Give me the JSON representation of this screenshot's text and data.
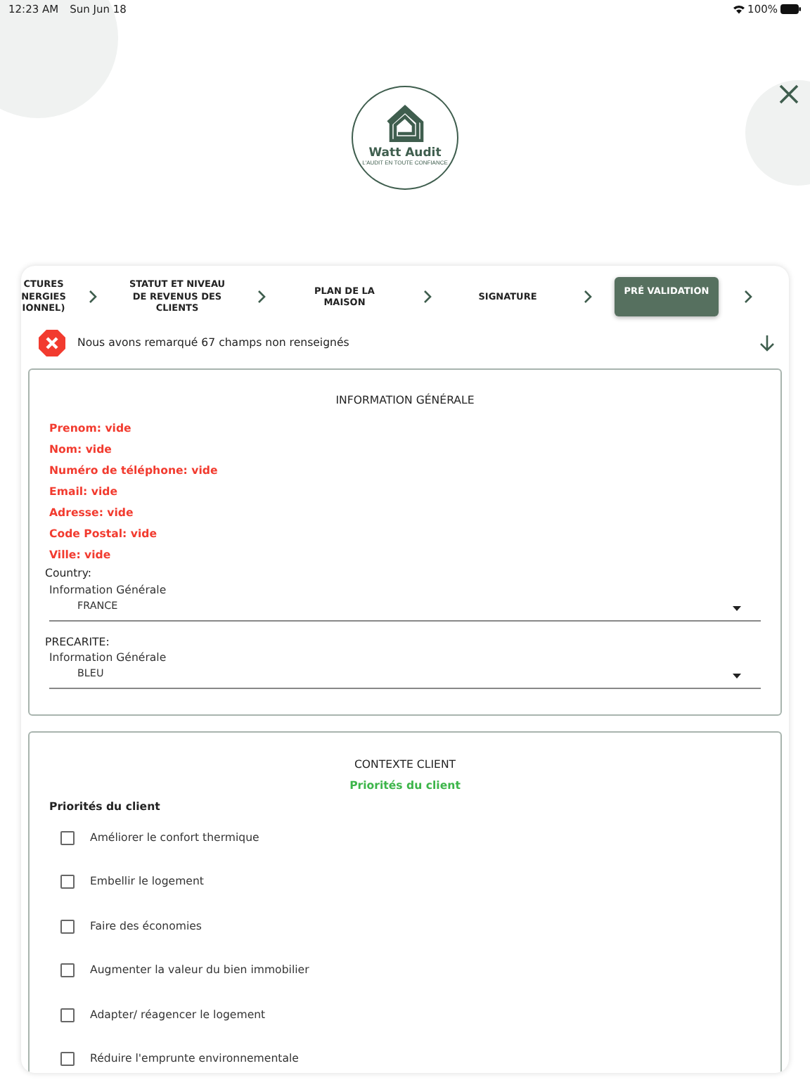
{
  "status_bar": {
    "time": "12:23 AM",
    "date": "Sun Jun 18",
    "battery": "100%"
  },
  "logo": {
    "title": "Watt Audit",
    "tagline": "L'AUDIT EN TOUTE CONFIANCE"
  },
  "steps": [
    {
      "label": "CTURES\nNERGIES\nIONNEL)",
      "selected": false
    },
    {
      "label": "STATUT ET NIVEAU\nDE REVENUS DES\nCLIENTS",
      "selected": false
    },
    {
      "label": "PLAN DE LA\nMAISON",
      "selected": false
    },
    {
      "label": "SIGNATURE",
      "selected": false
    },
    {
      "label": "PRÉ VALIDATION",
      "selected": true
    }
  ],
  "alert": {
    "text": "Nous avons remarqué 67 champs non renseignés"
  },
  "general": {
    "title": "INFORMATION GÉNÉRALE",
    "missing": [
      "Prenom: vide",
      "Nom: vide",
      "Numéro de téléphone: vide",
      "Email: vide",
      "Adresse: vide",
      "Code Postal: vide",
      "Ville: vide"
    ],
    "selects": [
      {
        "label": "Country:",
        "caption": "Information Générale",
        "value": "FRANCE"
      },
      {
        "label": "PRECARITE:",
        "caption": "Information Générale",
        "value": "BLEU"
      }
    ]
  },
  "context": {
    "title": "CONTEXTE CLIENT",
    "subtitle": "Priorités du client",
    "group_label": "Priorités du client",
    "options": [
      {
        "label": "Améliorer le confort thermique",
        "checked": false
      },
      {
        "label": "Embellir le logement",
        "checked": false
      },
      {
        "label": "Faire des économies",
        "checked": false
      },
      {
        "label": "Augmenter la valeur du bien immobilier",
        "checked": false
      },
      {
        "label": "Adapter/ réagencer le logement",
        "checked": false
      },
      {
        "label": "Réduire l'emprunte environnementale",
        "checked": false
      }
    ]
  }
}
